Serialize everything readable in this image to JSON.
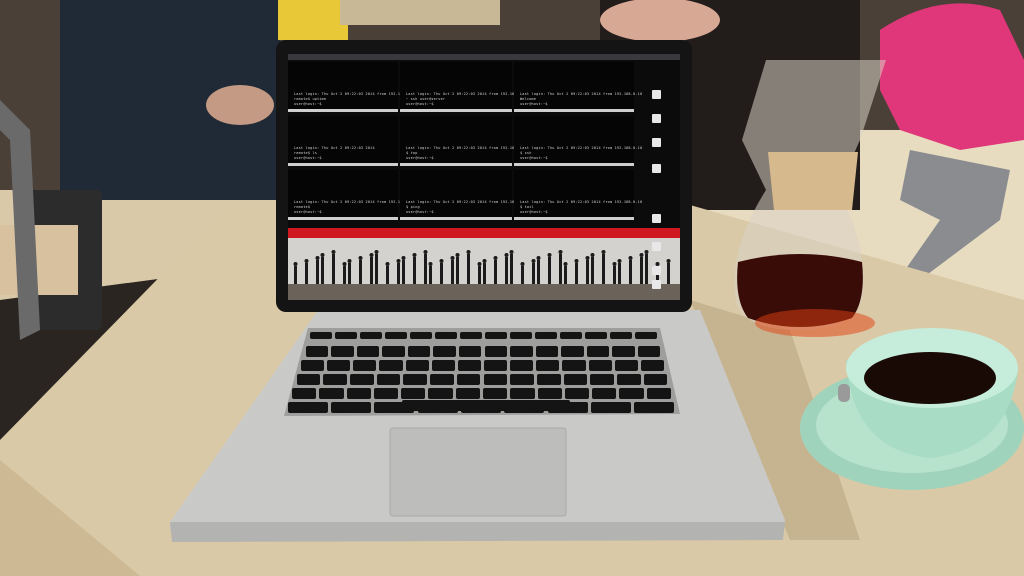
{
  "scene": {
    "description_colors": {
      "table": "#d8c8a8",
      "laptop_body": "#c9c9c7",
      "screen_bg": "#0b0b0c",
      "terminal_red": "#d01820",
      "coffee": "#3a0c08",
      "cup": "#a8dcc4"
    }
  },
  "screen": {
    "terminals": [
      {
        "lines": [
          "Last login: Thu Oct  2 09:22:03 2014 from 192.168.0.10",
          "remote$ uptime",
          "user@host:~$"
        ]
      },
      {
        "lines": [
          "Last login: Thu Oct  2 09:22:03 2014 from 192.168.0.10",
          "~ ssh user@server",
          "user@host:~$"
        ]
      },
      {
        "lines": [
          "Last login: Thu Oct  2 09:22:03 2014 from 192.168.0.10",
          "Welcome",
          "user@host:~$"
        ]
      },
      {
        "lines": [
          "Last login: Thu Oct  2 09:22:03 2014",
          "remote$ ls",
          "user@host:~$"
        ]
      },
      {
        "lines": [
          "Last login: Thu Oct  2 09:22:03 2014 from 192.168.0.10",
          "$ top",
          "user@host:~$"
        ]
      },
      {
        "lines": [
          "Last login: Thu Oct  2 09:22:03 2014 from 192.168.0.10",
          "$ ssh",
          "user@host:~$"
        ]
      },
      {
        "lines": [
          "Last login: Thu Oct  2 09:22:03 2014 from 192.168.0.10",
          "remote$",
          "user@host:~$"
        ]
      },
      {
        "lines": [
          "Last login: Thu Oct  2 09:22:03 2014 from 192.168.0.10",
          "$ ping",
          "user@host:~$"
        ]
      },
      {
        "lines": [
          "Last login: Thu Oct  2 09:22:03 2014 from 192.168.0.10",
          "$ tail",
          "user@host:~$"
        ]
      }
    ]
  },
  "keyboard": {
    "rows": 6
  }
}
